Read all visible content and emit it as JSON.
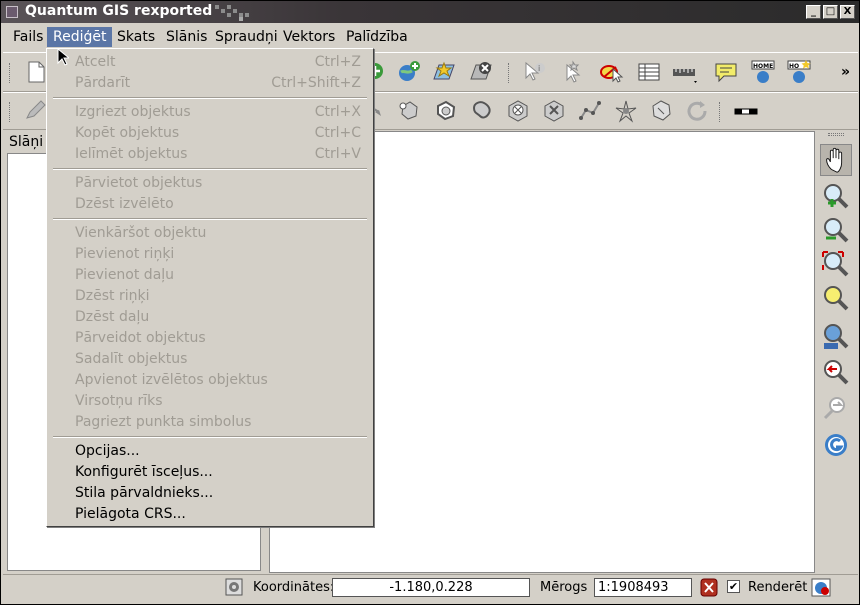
{
  "window": {
    "title": "Quantum GIS rexported",
    "buttons": [
      "_",
      "□",
      "X"
    ]
  },
  "menubar": {
    "items": [
      {
        "label": "Fails"
      },
      {
        "label": "Rediģēt"
      },
      {
        "label": "Skats"
      },
      {
        "label": "Slānis"
      },
      {
        "label": "Spraudņi"
      },
      {
        "label": "Vektors"
      },
      {
        "label": "Palīdzība"
      }
    ]
  },
  "edit_menu": {
    "items": [
      {
        "label": "Atcelt",
        "shortcut": "Ctrl+Z",
        "enabled": false
      },
      {
        "label": "Pārdarīt",
        "shortcut": "Ctrl+Shift+Z",
        "enabled": false
      },
      {
        "label": "Izgriezt objektus",
        "shortcut": "Ctrl+X",
        "enabled": false
      },
      {
        "label": "Kopēt objektus",
        "shortcut": "Ctrl+C",
        "enabled": false
      },
      {
        "label": "Ielīmēt objektus",
        "shortcut": "Ctrl+V",
        "enabled": false
      },
      {
        "label": "Pārvietot objektus",
        "shortcut": "",
        "enabled": false
      },
      {
        "label": "Dzēst izvēlēto",
        "shortcut": "",
        "enabled": false
      },
      {
        "label": "Vienkāršot objektu",
        "shortcut": "",
        "enabled": false
      },
      {
        "label": "Pievienot riņķi",
        "shortcut": "",
        "enabled": false
      },
      {
        "label": "Pievienot daļu",
        "shortcut": "",
        "enabled": false
      },
      {
        "label": "Dzēst riņķi",
        "shortcut": "",
        "enabled": false
      },
      {
        "label": "Dzēst daļu",
        "shortcut": "",
        "enabled": false
      },
      {
        "label": "Pārveidot objektus",
        "shortcut": "",
        "enabled": false
      },
      {
        "label": "Sadalīt objektus",
        "shortcut": "",
        "enabled": false
      },
      {
        "label": "Apvienot izvēlētos objektus",
        "shortcut": "",
        "enabled": false
      },
      {
        "label": "Virsotņu rīks",
        "shortcut": "",
        "enabled": false
      },
      {
        "label": "Pagriezt punkta simbolus",
        "shortcut": "",
        "enabled": false
      },
      {
        "label": "Opcijas...",
        "shortcut": "",
        "enabled": true
      },
      {
        "label": "Konfigurēt īsceļus...",
        "shortcut": "",
        "enabled": true
      },
      {
        "label": "Stila pārvaldnieks...",
        "shortcut": "",
        "enabled": true
      },
      {
        "label": "Pielāgota CRS...",
        "shortcut": "",
        "enabled": true
      }
    ]
  },
  "layers_panel": {
    "title": "Slāņi"
  },
  "toolbar_more": "»",
  "statusbar": {
    "coords_label": "Koordinātes:",
    "coords_value": "-1.180,0.228",
    "scale_label": "Mērogs",
    "scale_value": "1:1908493",
    "render_label": "Renderēt",
    "render_checked": true
  },
  "colors": {
    "menu_highlight": "#5b76a6",
    "chrome": "#d4d0c8",
    "disabled_text": "#a09c94"
  }
}
